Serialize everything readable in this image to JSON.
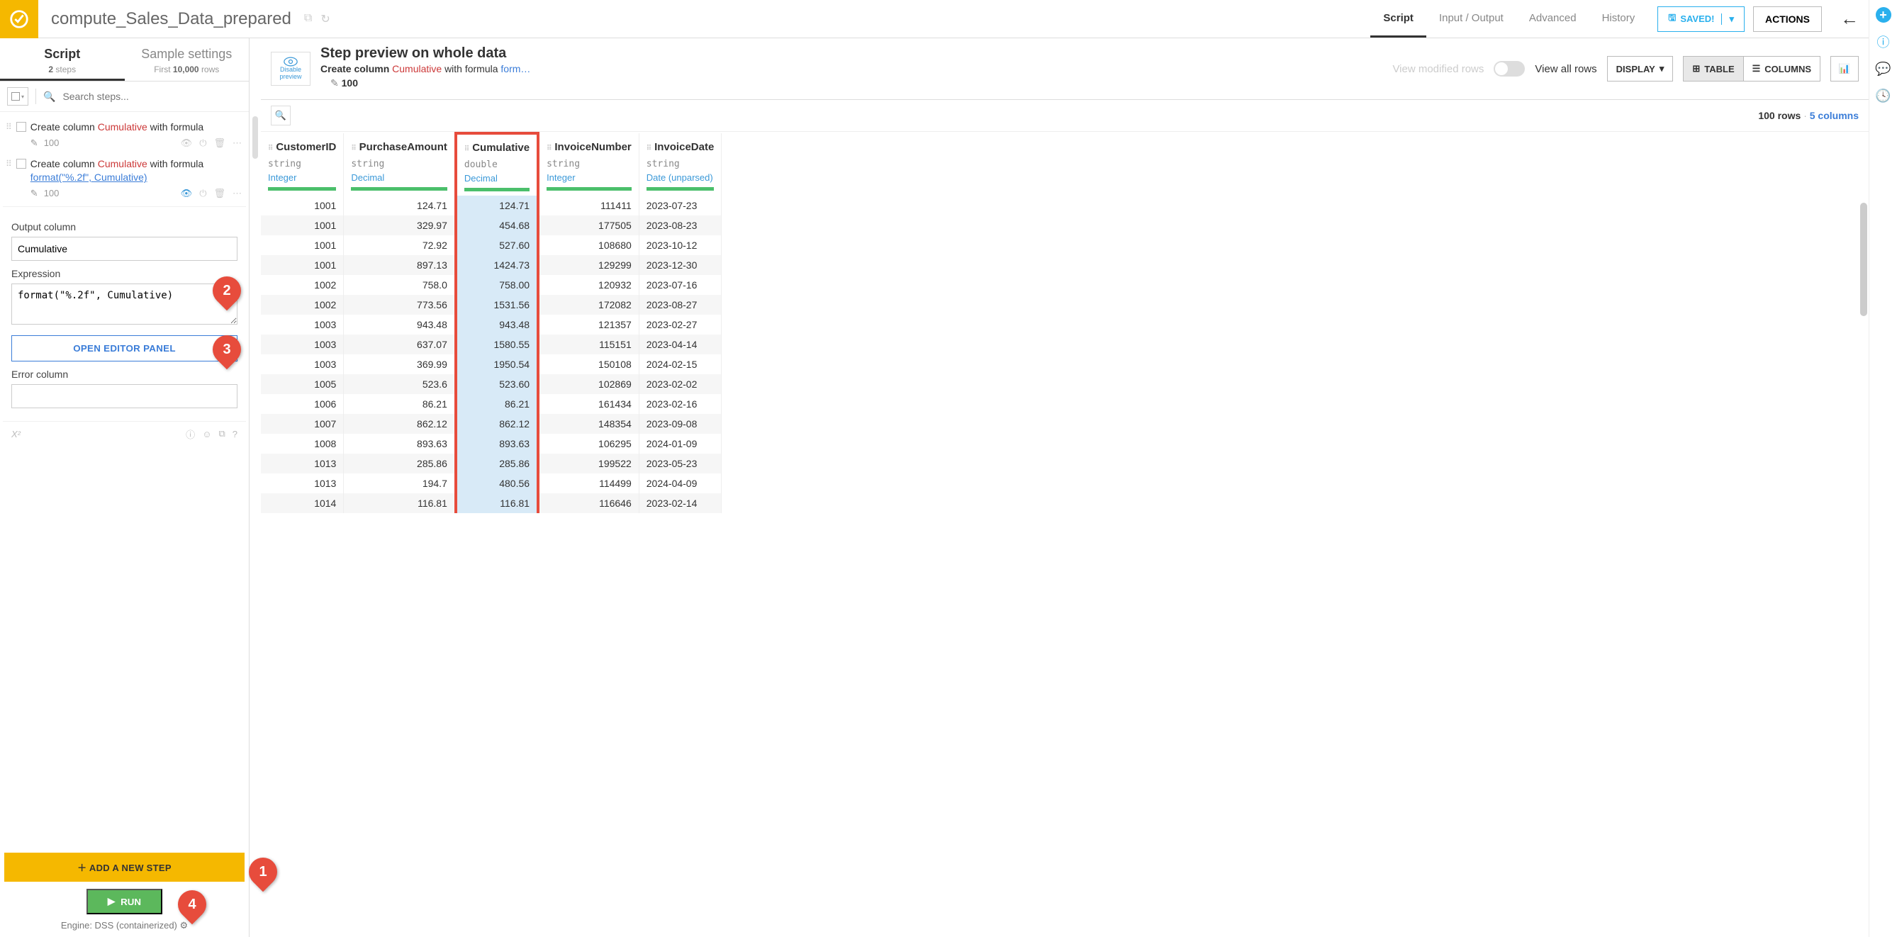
{
  "header": {
    "title": "compute_Sales_Data_prepared",
    "tabs": [
      "Script",
      "Input / Output",
      "Advanced",
      "History"
    ],
    "active_tab": "Script",
    "saved_label": "SAVED!",
    "actions_label": "ACTIONS"
  },
  "left": {
    "tabs": {
      "script": {
        "label": "Script",
        "sub_count": "2",
        "sub_unit": "steps"
      },
      "sample": {
        "label": "Sample settings",
        "sub_prefix": "First",
        "sub_count": "10,000",
        "sub_unit": "rows"
      }
    },
    "search_placeholder": "Search steps...",
    "steps": [
      {
        "prefix": "Create column",
        "colname": "Cumulative",
        "suffix": "with formula",
        "count": "100"
      },
      {
        "prefix": "Create column",
        "colname": "Cumulative",
        "suffix": "with formula",
        "formula_link": "format(\"%.2f\", Cumulative)",
        "count": "100",
        "active": true
      }
    ],
    "editor": {
      "output_label": "Output column",
      "output_value": "Cumulative",
      "expr_label": "Expression",
      "expr_value": "format(\"%.2f\", Cumulative)",
      "open_editor": "OPEN EDITOR PANEL",
      "error_label": "Error column"
    },
    "add_step": "ADD A NEW STEP",
    "run": "RUN",
    "engine": "Engine: DSS (containerized)"
  },
  "preview": {
    "disable_label": "Disable preview",
    "title": "Step preview on whole data",
    "sub_prefix": "Create column",
    "sub_col": "Cumulative",
    "sub_mid": "with formula",
    "sub_formula": "form…",
    "view_mod": "View modified rows",
    "view_all": "View all rows",
    "rowcount": "100",
    "display": "DISPLAY",
    "table_label": "TABLE",
    "columns_label": "COLUMNS",
    "stats_rows": "100 rows",
    "stats_cols": "5 columns"
  },
  "columns": [
    {
      "name": "CustomerID",
      "dtype": "string",
      "meaning": "Integer",
      "align": "num"
    },
    {
      "name": "PurchaseAmount",
      "dtype": "string",
      "meaning": "Decimal",
      "align": "num"
    },
    {
      "name": "Cumulative",
      "dtype": "double",
      "meaning": "Decimal",
      "align": "num",
      "highlight": true
    },
    {
      "name": "InvoiceNumber",
      "dtype": "string",
      "meaning": "Integer",
      "align": "num"
    },
    {
      "name": "InvoiceDate",
      "dtype": "string",
      "meaning": "Date (unparsed)",
      "align": "left"
    }
  ],
  "rows": [
    [
      "1001",
      "124.71",
      "124.71",
      "111411",
      "2023-07-23"
    ],
    [
      "1001",
      "329.97",
      "454.68",
      "177505",
      "2023-08-23"
    ],
    [
      "1001",
      "72.92",
      "527.60",
      "108680",
      "2023-10-12"
    ],
    [
      "1001",
      "897.13",
      "1424.73",
      "129299",
      "2023-12-30"
    ],
    [
      "1002",
      "758.0",
      "758.00",
      "120932",
      "2023-07-16"
    ],
    [
      "1002",
      "773.56",
      "1531.56",
      "172082",
      "2023-08-27"
    ],
    [
      "1003",
      "943.48",
      "943.48",
      "121357",
      "2023-02-27"
    ],
    [
      "1003",
      "637.07",
      "1580.55",
      "115151",
      "2023-04-14"
    ],
    [
      "1003",
      "369.99",
      "1950.54",
      "150108",
      "2024-02-15"
    ],
    [
      "1005",
      "523.6",
      "523.60",
      "102869",
      "2023-02-02"
    ],
    [
      "1006",
      "86.21",
      "86.21",
      "161434",
      "2023-02-16"
    ],
    [
      "1007",
      "862.12",
      "862.12",
      "148354",
      "2023-09-08"
    ],
    [
      "1008",
      "893.63",
      "893.63",
      "106295",
      "2024-01-09"
    ],
    [
      "1013",
      "285.86",
      "285.86",
      "199522",
      "2023-05-23"
    ],
    [
      "1013",
      "194.7",
      "480.56",
      "114499",
      "2024-04-09"
    ],
    [
      "1014",
      "116.81",
      "116.81",
      "116646",
      "2023-02-14"
    ]
  ],
  "annotations": [
    "1",
    "2",
    "3",
    "4"
  ]
}
